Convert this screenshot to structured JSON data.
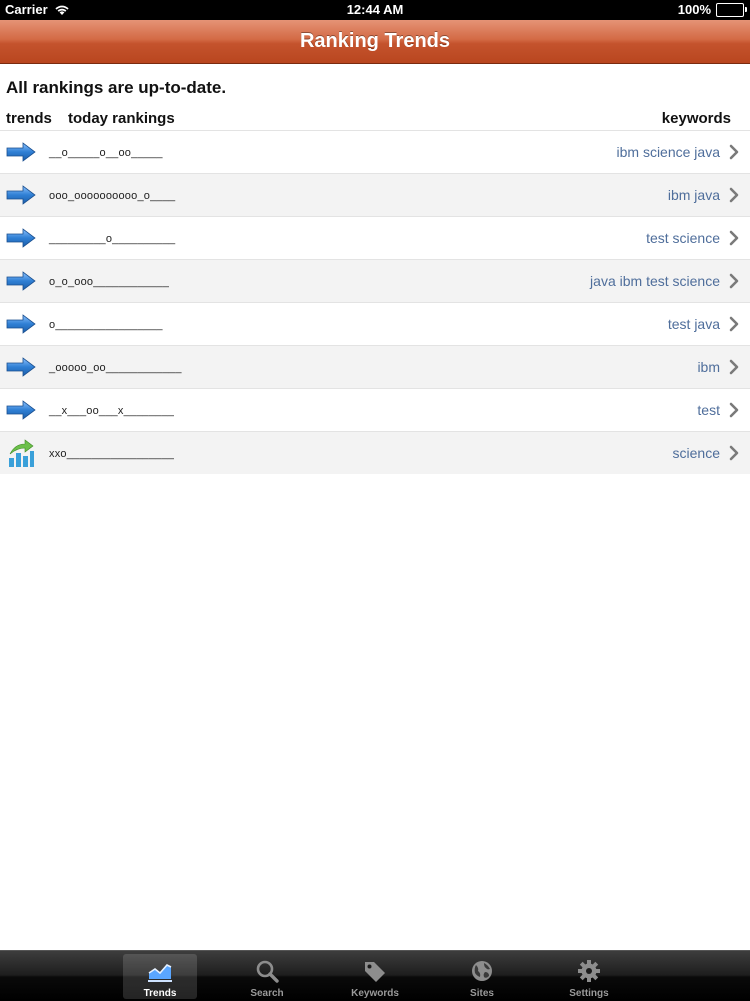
{
  "status_bar": {
    "carrier": "Carrier",
    "time": "12:44 AM",
    "battery": "100%"
  },
  "nav": {
    "title": "Ranking Trends"
  },
  "status_message": "All rankings are up-to-date.",
  "columns": {
    "trends": "trends",
    "today": "today rankings",
    "keywords": "keywords"
  },
  "rows": [
    {
      "trend_icon": "arrow-right-icon",
      "ranking": "__o_____o__oo_____",
      "keywords": "ibm science java"
    },
    {
      "trend_icon": "arrow-right-icon",
      "ranking": "ooo_oooooooooo_o____",
      "keywords": "ibm java"
    },
    {
      "trend_icon": "arrow-right-icon",
      "ranking": "_________o__________",
      "keywords": "test science"
    },
    {
      "trend_icon": "arrow-right-icon",
      "ranking": "o_o_ooo____________",
      "keywords": "java ibm test science"
    },
    {
      "trend_icon": "arrow-right-icon",
      "ranking": "o_________________",
      "keywords": "test java"
    },
    {
      "trend_icon": "arrow-right-icon",
      "ranking": "_ooooo_oo____________",
      "keywords": "ibm"
    },
    {
      "trend_icon": "arrow-right-icon",
      "ranking": "__x___oo___x________",
      "keywords": "test"
    },
    {
      "trend_icon": "trending-up-chart-icon",
      "ranking": "xxo_________________",
      "keywords": "science"
    }
  ],
  "tabs": [
    {
      "label": "Trends",
      "icon": "trends-chart-icon",
      "selected": true
    },
    {
      "label": "Search",
      "icon": "magnifier-icon",
      "selected": false
    },
    {
      "label": "Keywords",
      "icon": "tag-icon",
      "selected": false
    },
    {
      "label": "Sites",
      "icon": "globe-icon",
      "selected": false
    },
    {
      "label": "Settings",
      "icon": "gear-icon",
      "selected": false
    }
  ],
  "colors": {
    "nav_accent": "#c4532d",
    "keyword_text": "#4f6e9b",
    "arrow_blue": "#2f7fd4"
  }
}
